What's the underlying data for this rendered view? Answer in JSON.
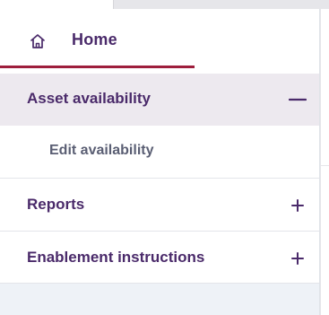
{
  "sidebar": {
    "home": {
      "label": "Home",
      "icon": "home-icon"
    },
    "items": [
      {
        "label": "Asset availability",
        "toggle": "minus-icon",
        "expanded": true
      },
      {
        "label": "Edit availability",
        "sub_item": true
      },
      {
        "label": "Reports",
        "toggle": "plus-icon",
        "expanded": false
      },
      {
        "label": "Enablement instructions",
        "toggle": "plus-icon",
        "expanded": false
      }
    ]
  },
  "colors": {
    "accent": "#4a2a6a",
    "active_underline": "#9e1e3c",
    "selected_background": "#ede9ef",
    "sidebar_background": "#eef2f7",
    "subitem_text": "#5a5e73"
  }
}
